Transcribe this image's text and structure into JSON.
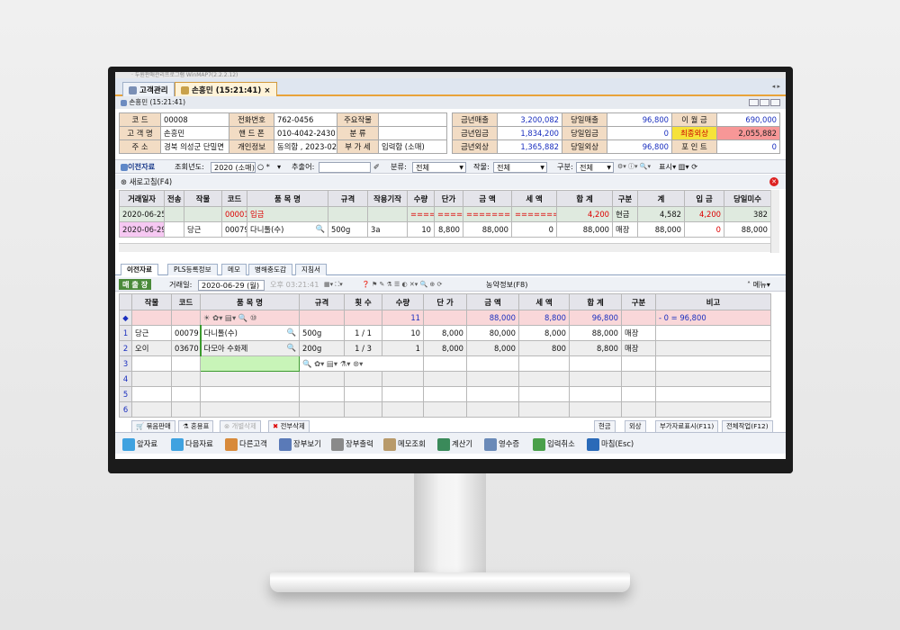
{
  "window": {
    "title": "· 두원판매관리프로그램 WinMAP7(2.2.2.12)"
  },
  "tabs": [
    {
      "label": "고객관리"
    },
    {
      "label": "손흥민 (15:21:41)"
    }
  ],
  "subwindow": {
    "title": "손흥민 (15:21:41)"
  },
  "customer": {
    "code_label": "코   드",
    "code": "00008",
    "phone_label": "전화번호",
    "phone": "762-0456",
    "main_work_label": "주요작물",
    "main_work": "",
    "name_label": "고 객 명",
    "name": "손흥민",
    "mobile_label": "핸 드 폰",
    "mobile": "010-4042-2430",
    "category_label": "분   류",
    "category": "",
    "addr_label": "주   소",
    "addr": "경북 의성군 단밀면",
    "privacy_label": "개인정보",
    "privacy": "동의함 , 2023-02-",
    "vat_label": "부 가 세",
    "vat": "입력함 (소매)"
  },
  "summary": {
    "r1": [
      {
        "label": "금년매출",
        "value": "3,200,082"
      },
      {
        "label": "당일매출",
        "value": "96,800"
      },
      {
        "label": "이 월 금",
        "value": "690,000"
      }
    ],
    "r2": [
      {
        "label": "금년입금",
        "value": "1,834,200"
      },
      {
        "label": "당일입금",
        "value": "0"
      },
      {
        "label": "최종외상",
        "value": "2,055,882"
      }
    ],
    "r3": [
      {
        "label": "금년외상",
        "value": "1,365,882"
      },
      {
        "label": "당일외상",
        "value": "96,800"
      },
      {
        "label": "포 인 트",
        "value": "0"
      }
    ]
  },
  "filter": {
    "prev_label": "이전자료",
    "year_label": "조회년도:",
    "year_value": "2020 (소매)",
    "radio": "○ *",
    "extract_label": "추출어:",
    "class_label": "분류:",
    "class_value": "전체",
    "crop_label": "작물:",
    "crop_value": "전체",
    "div_label": "구분:",
    "div_value": "전체",
    "display_label": "표시"
  },
  "refresh": {
    "label": "새로고침(F4)"
  },
  "history": {
    "headers": [
      "거래일자",
      "전송",
      "작물",
      "코드",
      "품 목 명",
      "규격",
      "작용기작",
      "수량",
      "단가",
      "금 액",
      "세 액",
      "합 계",
      "구분",
      "계",
      "입 금",
      "당일미수"
    ],
    "rows": [
      [
        "2020-06-25",
        "",
        "",
        "00001",
        "입금",
        "",
        "",
        "=====",
        "======",
        "========",
        "========",
        "4,200",
        "현금",
        "4,582",
        "4,200",
        "382"
      ],
      [
        "2020-06-29",
        "",
        "당근",
        "00079",
        "다니톨(수)",
        "500g",
        "3a",
        "10",
        "8,800",
        "88,000",
        "0",
        "88,000",
        "매장",
        "88,000",
        "0",
        "88,000"
      ]
    ]
  },
  "subtabs": [
    {
      "label": "이전자료"
    },
    {
      "label": "PLS등록정보"
    },
    {
      "label": "메모"
    },
    {
      "label": "병해충도감"
    },
    {
      "label": "지침서"
    }
  ],
  "sale": {
    "tag": "매 출 장",
    "date_label": "거래일:",
    "date_value": "2020-06-29 (월)",
    "time": "오후 03:21:41",
    "contract": "농약정보(F8)",
    "menu": "메뉴"
  },
  "entry": {
    "headers": [
      "",
      "작물",
      "코드",
      "품  목  명",
      "규격",
      "횟 수",
      "수량",
      "단 가",
      "금 액",
      "세 액",
      "합 계",
      "구분",
      "비고"
    ],
    "sum": {
      "qty": "11",
      "amount": "88,000",
      "tax": "8,800",
      "total": "96,800",
      "memo": "- 0 = 96,800"
    },
    "rows": [
      {
        "no": "1",
        "crop": "당근",
        "code": "00079",
        "name": "다니톨(수)",
        "spec": "500g",
        "count": "1 / 1",
        "qty": "10",
        "price": "8,000",
        "amount": "80,000",
        "tax": "8,000",
        "total": "88,000",
        "div": "매장",
        "memo": ""
      },
      {
        "no": "2",
        "crop": "오이",
        "code": "03670",
        "name": "다모아 수화제",
        "spec": "200g",
        "count": "1 / 3",
        "qty": "1",
        "price": "8,000",
        "amount": "8,000",
        "tax": "800",
        "total": "8,800",
        "div": "매장",
        "memo": ""
      },
      {
        "no": "3"
      },
      {
        "no": "4"
      },
      {
        "no": "5"
      },
      {
        "no": "6"
      }
    ]
  },
  "bottom_tabs": [
    {
      "label": "묶음판매"
    },
    {
      "label": "혼용표"
    },
    {
      "label": "개별삭제"
    },
    {
      "label": "전부삭제"
    },
    {
      "label": "현금"
    },
    {
      "label": "외상"
    },
    {
      "label": "부가자료표시(F11)"
    },
    {
      "label": "전체작업(F12)"
    }
  ],
  "toolbar": [
    {
      "label": "앞자료"
    },
    {
      "label": "다음자료"
    },
    {
      "label": "다른고객"
    },
    {
      "label": "장부보기"
    },
    {
      "label": "장부출력"
    },
    {
      "label": "메모조회"
    },
    {
      "label": "계산기"
    },
    {
      "label": "영수증"
    },
    {
      "label": "입력취소"
    },
    {
      "label": "마침(Esc)"
    }
  ],
  "colors": {
    "label_bg": "#f2dcc4",
    "warn_bg": "#f6e23a",
    "warn_value_bg": "#f79797",
    "sum_row_bg": "#f9d7d9",
    "tab_active": "#fff3d8"
  }
}
